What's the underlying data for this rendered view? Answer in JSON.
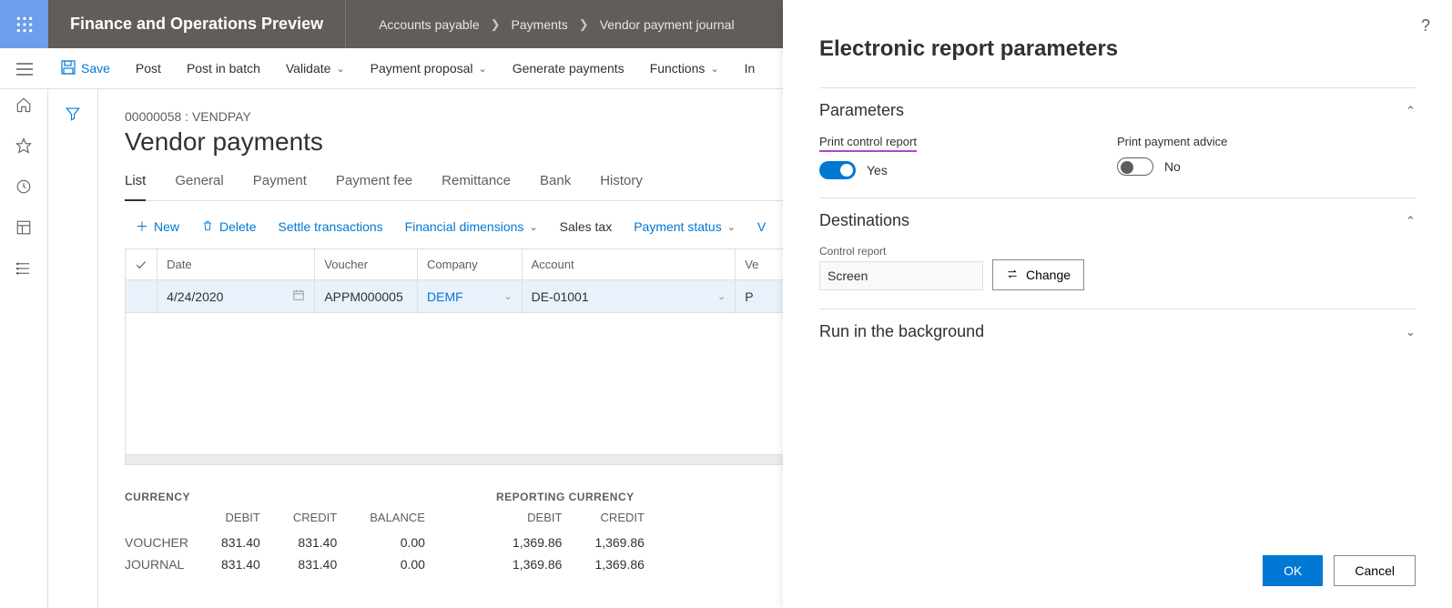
{
  "header": {
    "app_title": "Finance and Operations Preview",
    "breadcrumb": [
      "Accounts payable",
      "Payments",
      "Vendor payment journal"
    ]
  },
  "actionbar": {
    "save": "Save",
    "post": "Post",
    "post_batch": "Post in batch",
    "validate": "Validate",
    "proposal": "Payment proposal",
    "generate": "Generate payments",
    "functions": "Functions",
    "inquiries_partial": "In"
  },
  "page": {
    "record_id": "00000058 : VENDPAY",
    "title": "Vendor payments",
    "tabs": [
      "List",
      "General",
      "Payment",
      "Payment fee",
      "Remittance",
      "Bank",
      "History"
    ]
  },
  "grid_toolbar": {
    "new": "New",
    "delete": "Delete",
    "settle": "Settle transactions",
    "fin_dim": "Financial dimensions",
    "sales_tax": "Sales tax",
    "pay_status": "Payment status",
    "last_partial": "V"
  },
  "grid": {
    "headers": {
      "date": "Date",
      "voucher": "Voucher",
      "company": "Company",
      "account": "Account",
      "vendor_partial": "Ve"
    },
    "row": {
      "date": "4/24/2020",
      "voucher": "APPM000005",
      "company": "DEMF",
      "account": "DE-01001",
      "vendor_partial": "P"
    }
  },
  "totals": {
    "currency_label": "CURRENCY",
    "reporting_label": "REPORTING CURRENCY",
    "cols": {
      "debit": "DEBIT",
      "credit": "CREDIT",
      "balance": "BALANCE"
    },
    "rows": {
      "voucher": "VOUCHER",
      "journal": "JOURNAL"
    },
    "currency": {
      "voucher": {
        "debit": "831.40",
        "credit": "831.40",
        "balance": "0.00"
      },
      "journal": {
        "debit": "831.40",
        "credit": "831.40",
        "balance": "0.00"
      }
    },
    "reporting": {
      "voucher": {
        "debit": "1,369.86",
        "credit": "1,369.86",
        "balance_partial": ""
      },
      "journal": {
        "debit": "1,369.86",
        "credit": "1,369.86",
        "balance_partial": ""
      }
    }
  },
  "panel": {
    "title": "Electronic report parameters",
    "sections": {
      "parameters": "Parameters",
      "destinations": "Destinations",
      "background": "Run in the background"
    },
    "params": {
      "print_control_label": "Print control report",
      "print_control_value": "Yes",
      "print_advice_label": "Print payment advice",
      "print_advice_value": "No"
    },
    "dest": {
      "control_report_label": "Control report",
      "control_report_value": "Screen",
      "change": "Change"
    },
    "buttons": {
      "ok": "OK",
      "cancel": "Cancel"
    }
  }
}
